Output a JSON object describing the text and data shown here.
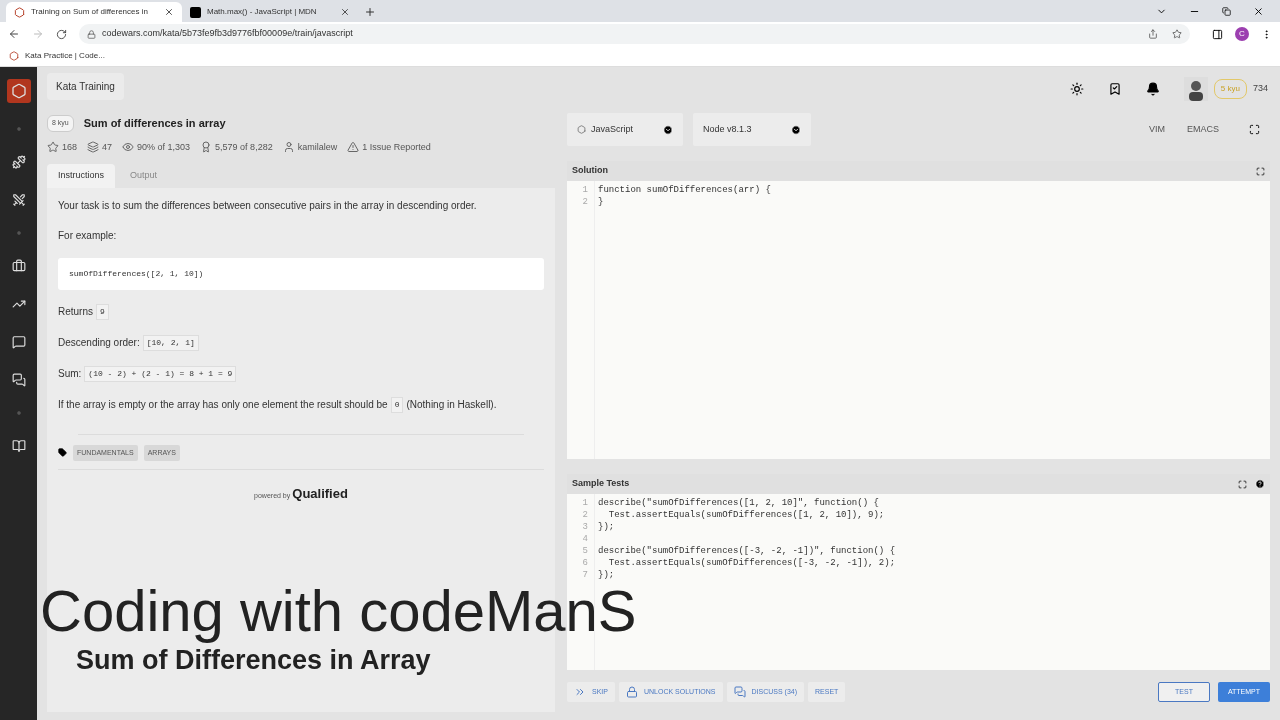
{
  "browser": {
    "tabs": [
      {
        "title": "Training on Sum of differences in",
        "selected": true,
        "kind": "codewars"
      },
      {
        "title": "Math.max() - JavaScript | MDN",
        "selected": false,
        "kind": "mdn"
      }
    ],
    "url": "codewars.com/kata/5b73fe9fb3d9776fbf00009e/train/javascript",
    "profile_initial": "C",
    "bookmarks": [
      "Kata Practice | Code..."
    ]
  },
  "header": {
    "breadcrumb": "Kata Training",
    "rank": "5 kyu",
    "honor": "734"
  },
  "kata": {
    "rank": "8 kyu",
    "title": "Sum of differences in array",
    "stats": [
      {
        "kind": "star",
        "text": "168"
      },
      {
        "kind": "collection",
        "text": "47"
      },
      {
        "kind": "satisfaction",
        "text": "90% of 1,303"
      },
      {
        "kind": "completed",
        "text": "5,579 of 8,282"
      },
      {
        "kind": "author",
        "text": "kamilalew"
      },
      {
        "kind": "issues",
        "text": "1 Issue Reported"
      }
    ]
  },
  "panel_tabs": [
    {
      "label": "Instructions",
      "selected": true
    },
    {
      "label": "Output",
      "selected": false
    }
  ],
  "instructions": [
    {
      "kind": "para",
      "parts": [
        {
          "text": "Your task is to sum the differences between consecutive pairs in the array in descending order."
        }
      ]
    },
    {
      "kind": "para",
      "parts": [
        {
          "text": "For example:"
        }
      ]
    },
    {
      "kind": "code_block",
      "parts": [
        {
          "code": "sumOfDifferences([2, 1, 10])"
        }
      ]
    },
    {
      "kind": "para",
      "parts": [
        {
          "text": "Returns"
        },
        {
          "code": "9"
        }
      ]
    },
    {
      "kind": "para",
      "parts": [
        {
          "text": "Descending order:"
        },
        {
          "code": "[10, 2, 1]"
        }
      ]
    },
    {
      "kind": "para",
      "parts": [
        {
          "text": "Sum:"
        },
        {
          "code": "(10 - 2) + (2 - 1) = 8 + 1 = 9"
        }
      ]
    },
    {
      "kind": "para",
      "parts": [
        {
          "text": "If the array is empty or the array has only one element the result should be"
        },
        {
          "code": "0"
        },
        {
          "text": "(Nothing in Haskell)."
        }
      ]
    }
  ],
  "tags": [
    "FUNDAMENTALS",
    "ARRAYS"
  ],
  "powered_by": {
    "prefix": "powered by",
    "brand": "Qualified"
  },
  "editor": {
    "language": "JavaScript",
    "version": "Node v8.1.3",
    "modes": [
      "VIM",
      "EMACS"
    ],
    "solution": {
      "title": "Solution",
      "lines": [
        {
          "number": "1",
          "code": "function sumOfDifferences(arr) {"
        },
        {
          "number": "2",
          "code": "}"
        }
      ]
    },
    "tests": {
      "title": "Sample Tests",
      "lines": [
        {
          "number": "1",
          "code": "describe(\"sumOfDifferences([1, 2, 10]\", function() {"
        },
        {
          "number": "2",
          "code": "  Test.assertEquals(sumOfDifferences([1, 2, 10]), 9);"
        },
        {
          "number": "3",
          "code": "});"
        },
        {
          "number": "4"
        },
        {
          "number": "5",
          "code": "describe(\"sumOfDifferences([-3, -2, -1])\", function() {"
        },
        {
          "number": "6",
          "code": "  Test.assertEquals(sumOfDifferences([-3, -2, -1]), 2);"
        },
        {
          "number": "7",
          "code": "});"
        }
      ]
    }
  },
  "actions": [
    {
      "kind": "skip",
      "label": "SKIP"
    },
    {
      "kind": "unlock",
      "label": "UNLOCK SOLUTIONS"
    },
    {
      "kind": "discuss",
      "label": "DISCUSS (34)"
    },
    {
      "kind": "reset",
      "label": "RESET"
    }
  ],
  "run_buttons": [
    {
      "kind": "outline",
      "label": "TEST"
    },
    {
      "kind": "primary",
      "label": "ATTEMPT"
    }
  ],
  "caption": {
    "title": "Coding with codeManS",
    "subtitle": "Sum of Differences in Array"
  }
}
